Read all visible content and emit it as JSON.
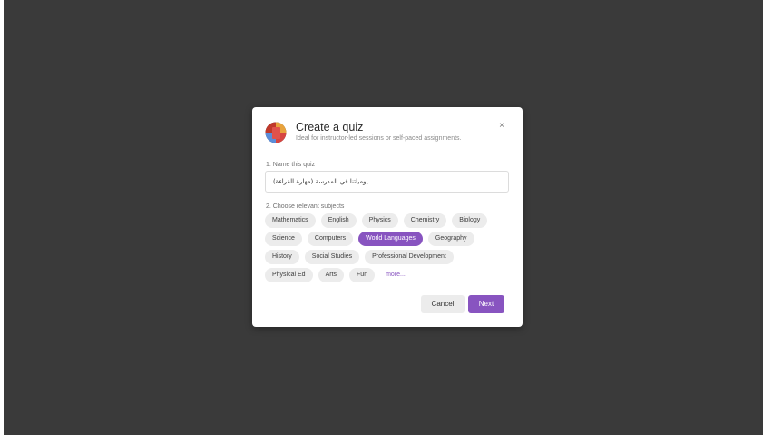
{
  "modal": {
    "title": "Create a quiz",
    "subtitle": "Ideal for instructor-led sessions or self-paced assignments.",
    "close_label": "×",
    "logo_icon": "quizizz-logo-icon"
  },
  "name_section": {
    "label": "1. Name this quiz",
    "value": "يومياتنا في المدرسة (مهارة القراءة)"
  },
  "subjects_section": {
    "label": "2. Choose relevant subjects",
    "rows": [
      [
        "Mathematics",
        "English",
        "Physics",
        "Chemistry",
        "Biology"
      ],
      [
        "Science",
        "Computers",
        "World Languages",
        "Geography"
      ],
      [
        "History",
        "Social Studies",
        "Professional Development"
      ],
      [
        "Physical Ed",
        "Arts",
        "Fun"
      ]
    ],
    "selected": "World Languages",
    "more_label": "more..."
  },
  "actions": {
    "cancel_label": "Cancel",
    "next_label": "Next"
  },
  "colors": {
    "backdrop": "#3a3a3a",
    "accent": "#8854c0",
    "chip_bg": "#ececec"
  }
}
